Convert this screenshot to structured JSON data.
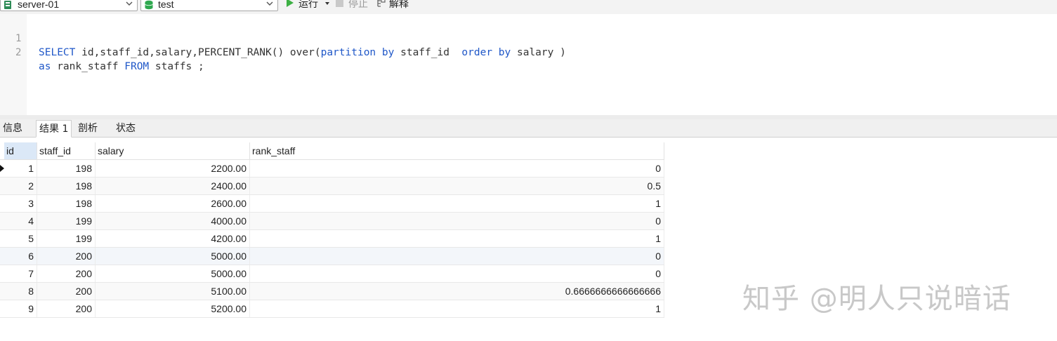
{
  "toolbar": {
    "connection": {
      "value": "server-01",
      "icon": "server-icon",
      "color": "#2e8b57"
    },
    "database": {
      "value": "test",
      "icon": "database-icon",
      "color": "#2fa84f"
    },
    "run_label": "运行",
    "stop_label": "停止",
    "explain_label": "解释"
  },
  "editor": {
    "line_numbers": [
      "1",
      "2"
    ],
    "lines": [
      [
        {
          "t": "SELECT",
          "k": true
        },
        {
          "t": " id,staff_id,salary,PERCENT_RANK() over(",
          "k": false
        },
        {
          "t": "partition",
          "k": true
        },
        {
          "t": " ",
          "k": false
        },
        {
          "t": "by",
          "k": true
        },
        {
          "t": " staff_id  ",
          "k": false
        },
        {
          "t": "order",
          "k": true
        },
        {
          "t": " ",
          "k": false
        },
        {
          "t": "by",
          "k": true
        },
        {
          "t": " salary )",
          "k": false
        }
      ],
      [
        {
          "t": "as",
          "k": true
        },
        {
          "t": " rank_staff ",
          "k": false
        },
        {
          "t": "FROM",
          "k": true
        },
        {
          "t": " staffs ;",
          "k": false
        }
      ]
    ],
    "keyword_color": "#1f57c8"
  },
  "tabs": [
    {
      "label": "信息",
      "active": false
    },
    {
      "label": "结果 1",
      "active": true
    },
    {
      "label": "剖析",
      "active": false
    },
    {
      "label": "状态",
      "active": false
    }
  ],
  "grid": {
    "columns": [
      "id",
      "staff_id",
      "salary",
      "rank_staff"
    ],
    "rows": [
      [
        "1",
        "198",
        "2200.00",
        "0"
      ],
      [
        "2",
        "198",
        "2400.00",
        "0.5"
      ],
      [
        "3",
        "198",
        "2600.00",
        "1"
      ],
      [
        "4",
        "199",
        "4000.00",
        "0"
      ],
      [
        "5",
        "199",
        "4200.00",
        "1"
      ],
      [
        "6",
        "200",
        "5000.00",
        "0"
      ],
      [
        "7",
        "200",
        "5000.00",
        "0"
      ],
      [
        "8",
        "200",
        "5100.00",
        "0.6666666666666666"
      ],
      [
        "9",
        "200",
        "5200.00",
        "1"
      ]
    ],
    "current_row": 1
  },
  "watermark": {
    "text": "知乎 @明人只说暗话"
  }
}
